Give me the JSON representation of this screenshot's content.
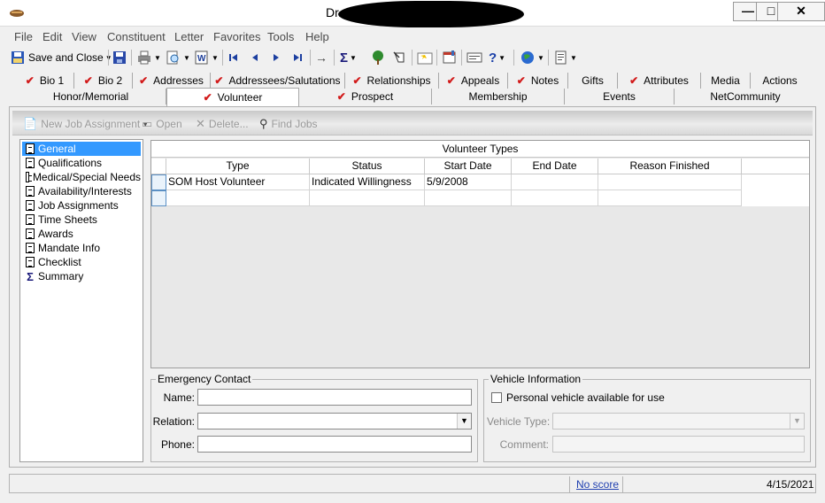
{
  "window": {
    "title": "Dr... and Kati...",
    "buttons": {
      "minimize": "—",
      "maximize": "□",
      "close": "✕"
    }
  },
  "menu": [
    "File",
    "Edit",
    "View",
    "Constituent",
    "Letter",
    "Favorites",
    "Tools",
    "Help"
  ],
  "toolbar": {
    "save_close_label": "Save and Close",
    "icons": [
      "save-icon",
      "print-icon",
      "preview-icon",
      "word-icon",
      "first-record-icon",
      "previous-record-icon",
      "next-record-icon",
      "last-record-icon",
      "goto-icon",
      "summary-icon",
      "tree-icon",
      "query-icon",
      "folder-icon",
      "notepad-icon",
      "card-icon",
      "help-icon",
      "globe-icon",
      "page-icon"
    ]
  },
  "tabs_row1": [
    {
      "label": "Bio 1",
      "checked": true
    },
    {
      "label": "Bio 2",
      "checked": true
    },
    {
      "label": "Addresses",
      "checked": true
    },
    {
      "label": "Addressees/Salutations",
      "checked": true
    },
    {
      "label": "Relationships",
      "checked": true
    },
    {
      "label": "Appeals",
      "checked": true
    },
    {
      "label": "Notes",
      "checked": true
    },
    {
      "label": "Gifts",
      "checked": false
    },
    {
      "label": "Attributes",
      "checked": true
    },
    {
      "label": "Media",
      "checked": false
    },
    {
      "label": "Actions",
      "checked": false
    }
  ],
  "tabs_row2": [
    {
      "label": "Honor/Memorial",
      "checked": false
    },
    {
      "label": "Volunteer",
      "checked": true,
      "active": true
    },
    {
      "label": "Prospect",
      "checked": true
    },
    {
      "label": "Membership",
      "checked": false
    },
    {
      "label": "Events",
      "checked": false
    },
    {
      "label": "NetCommunity",
      "checked": false
    }
  ],
  "content_toolbar": {
    "new_job": "New Job Assignment",
    "open": "Open",
    "delete": "Delete...",
    "find_jobs": "Find Jobs"
  },
  "nav_items": [
    {
      "label": "General",
      "selected": true,
      "icon": "document-icon"
    },
    {
      "label": "Qualifications",
      "icon": "document-icon"
    },
    {
      "label": "Medical/Special Needs",
      "icon": "document-icon"
    },
    {
      "label": "Availability/Interests",
      "icon": "document-icon"
    },
    {
      "label": "Job Assignments",
      "icon": "document-icon"
    },
    {
      "label": "Time Sheets",
      "icon": "document-icon"
    },
    {
      "label": "Awards",
      "icon": "document-icon"
    },
    {
      "label": "Mandate Info",
      "icon": "document-icon"
    },
    {
      "label": "Checklist",
      "icon": "document-icon"
    },
    {
      "label": "Summary",
      "icon": "sigma-icon"
    }
  ],
  "volunteer_types": {
    "title": "Volunteer Types",
    "columns": [
      "Type",
      "Status",
      "Start Date",
      "End Date",
      "Reason Finished"
    ],
    "rows": [
      [
        "SOM Host Volunteer",
        "Indicated Willingness",
        "5/9/2008",
        "",
        ""
      ],
      [
        "",
        "",
        "",
        "",
        ""
      ]
    ]
  },
  "emergency_contact": {
    "legend": "Emergency Contact",
    "name_label": "Name:",
    "relation_label": "Relation:",
    "phone_label": "Phone:",
    "name_value": "",
    "relation_value": "",
    "phone_value": ""
  },
  "vehicle_info": {
    "legend": "Vehicle Information",
    "personal_vehicle_label": "Personal vehicle available for use",
    "personal_vehicle_checked": false,
    "vehicle_type_label": "Vehicle Type:",
    "comment_label": "Comment:",
    "vehicle_type_value": "",
    "comment_value": ""
  },
  "statusbar": {
    "score_link": "No score",
    "date": "4/15/2021"
  }
}
